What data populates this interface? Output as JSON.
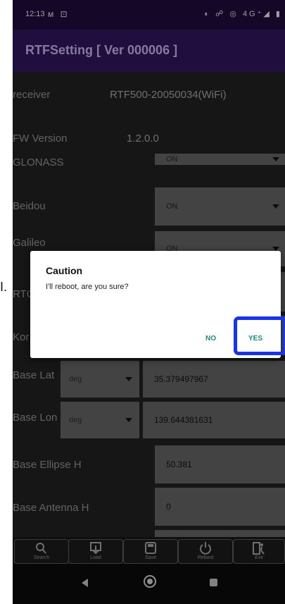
{
  "status_bar": {
    "time": "12:13",
    "left_icons": "ᴍ ⊡",
    "right_icons": "◐ ☍ ◎ 4G⁺◢ ▮"
  },
  "app_bar": {
    "title": "RTFSetting  [ Ver 000006 ]"
  },
  "info": {
    "receiver_label": "receiver",
    "receiver_value": "RTF500-20050034(WiFi)",
    "fw_label": "FW Version",
    "fw_value": "1.2.0.0"
  },
  "settings": [
    {
      "label": "GLONASS",
      "value": "ON"
    },
    {
      "label": "Beidou",
      "value": "ON"
    },
    {
      "label": "Galileo",
      "value": "ON"
    },
    {
      "label": "RTC",
      "value": ""
    },
    {
      "label": "Kor",
      "value": ""
    }
  ],
  "base_lat": {
    "label": "Base Lat",
    "unit": "deg",
    "value": "35.379497967"
  },
  "base_lon": {
    "label": "Base Lon",
    "unit": "deg",
    "value": "139.644381631"
  },
  "base_ellipse": {
    "label": "Base Ellipse H",
    "value": "50.381"
  },
  "base_antenna": {
    "label": "Base Antenna H",
    "value": "0"
  },
  "toolbar": {
    "search": "Search",
    "load": "Load",
    "save": "Save",
    "reboot": "Reboot",
    "exit": "Exit"
  },
  "dialog": {
    "title": "Caution",
    "message": "I'll reboot, are you sure?",
    "no": "NO",
    "yes": "YES"
  },
  "outside_text": "I.",
  "colors": {
    "appbar": "#2b1456",
    "accent": "#1f8a7a",
    "highlight": "#1a34e6"
  }
}
